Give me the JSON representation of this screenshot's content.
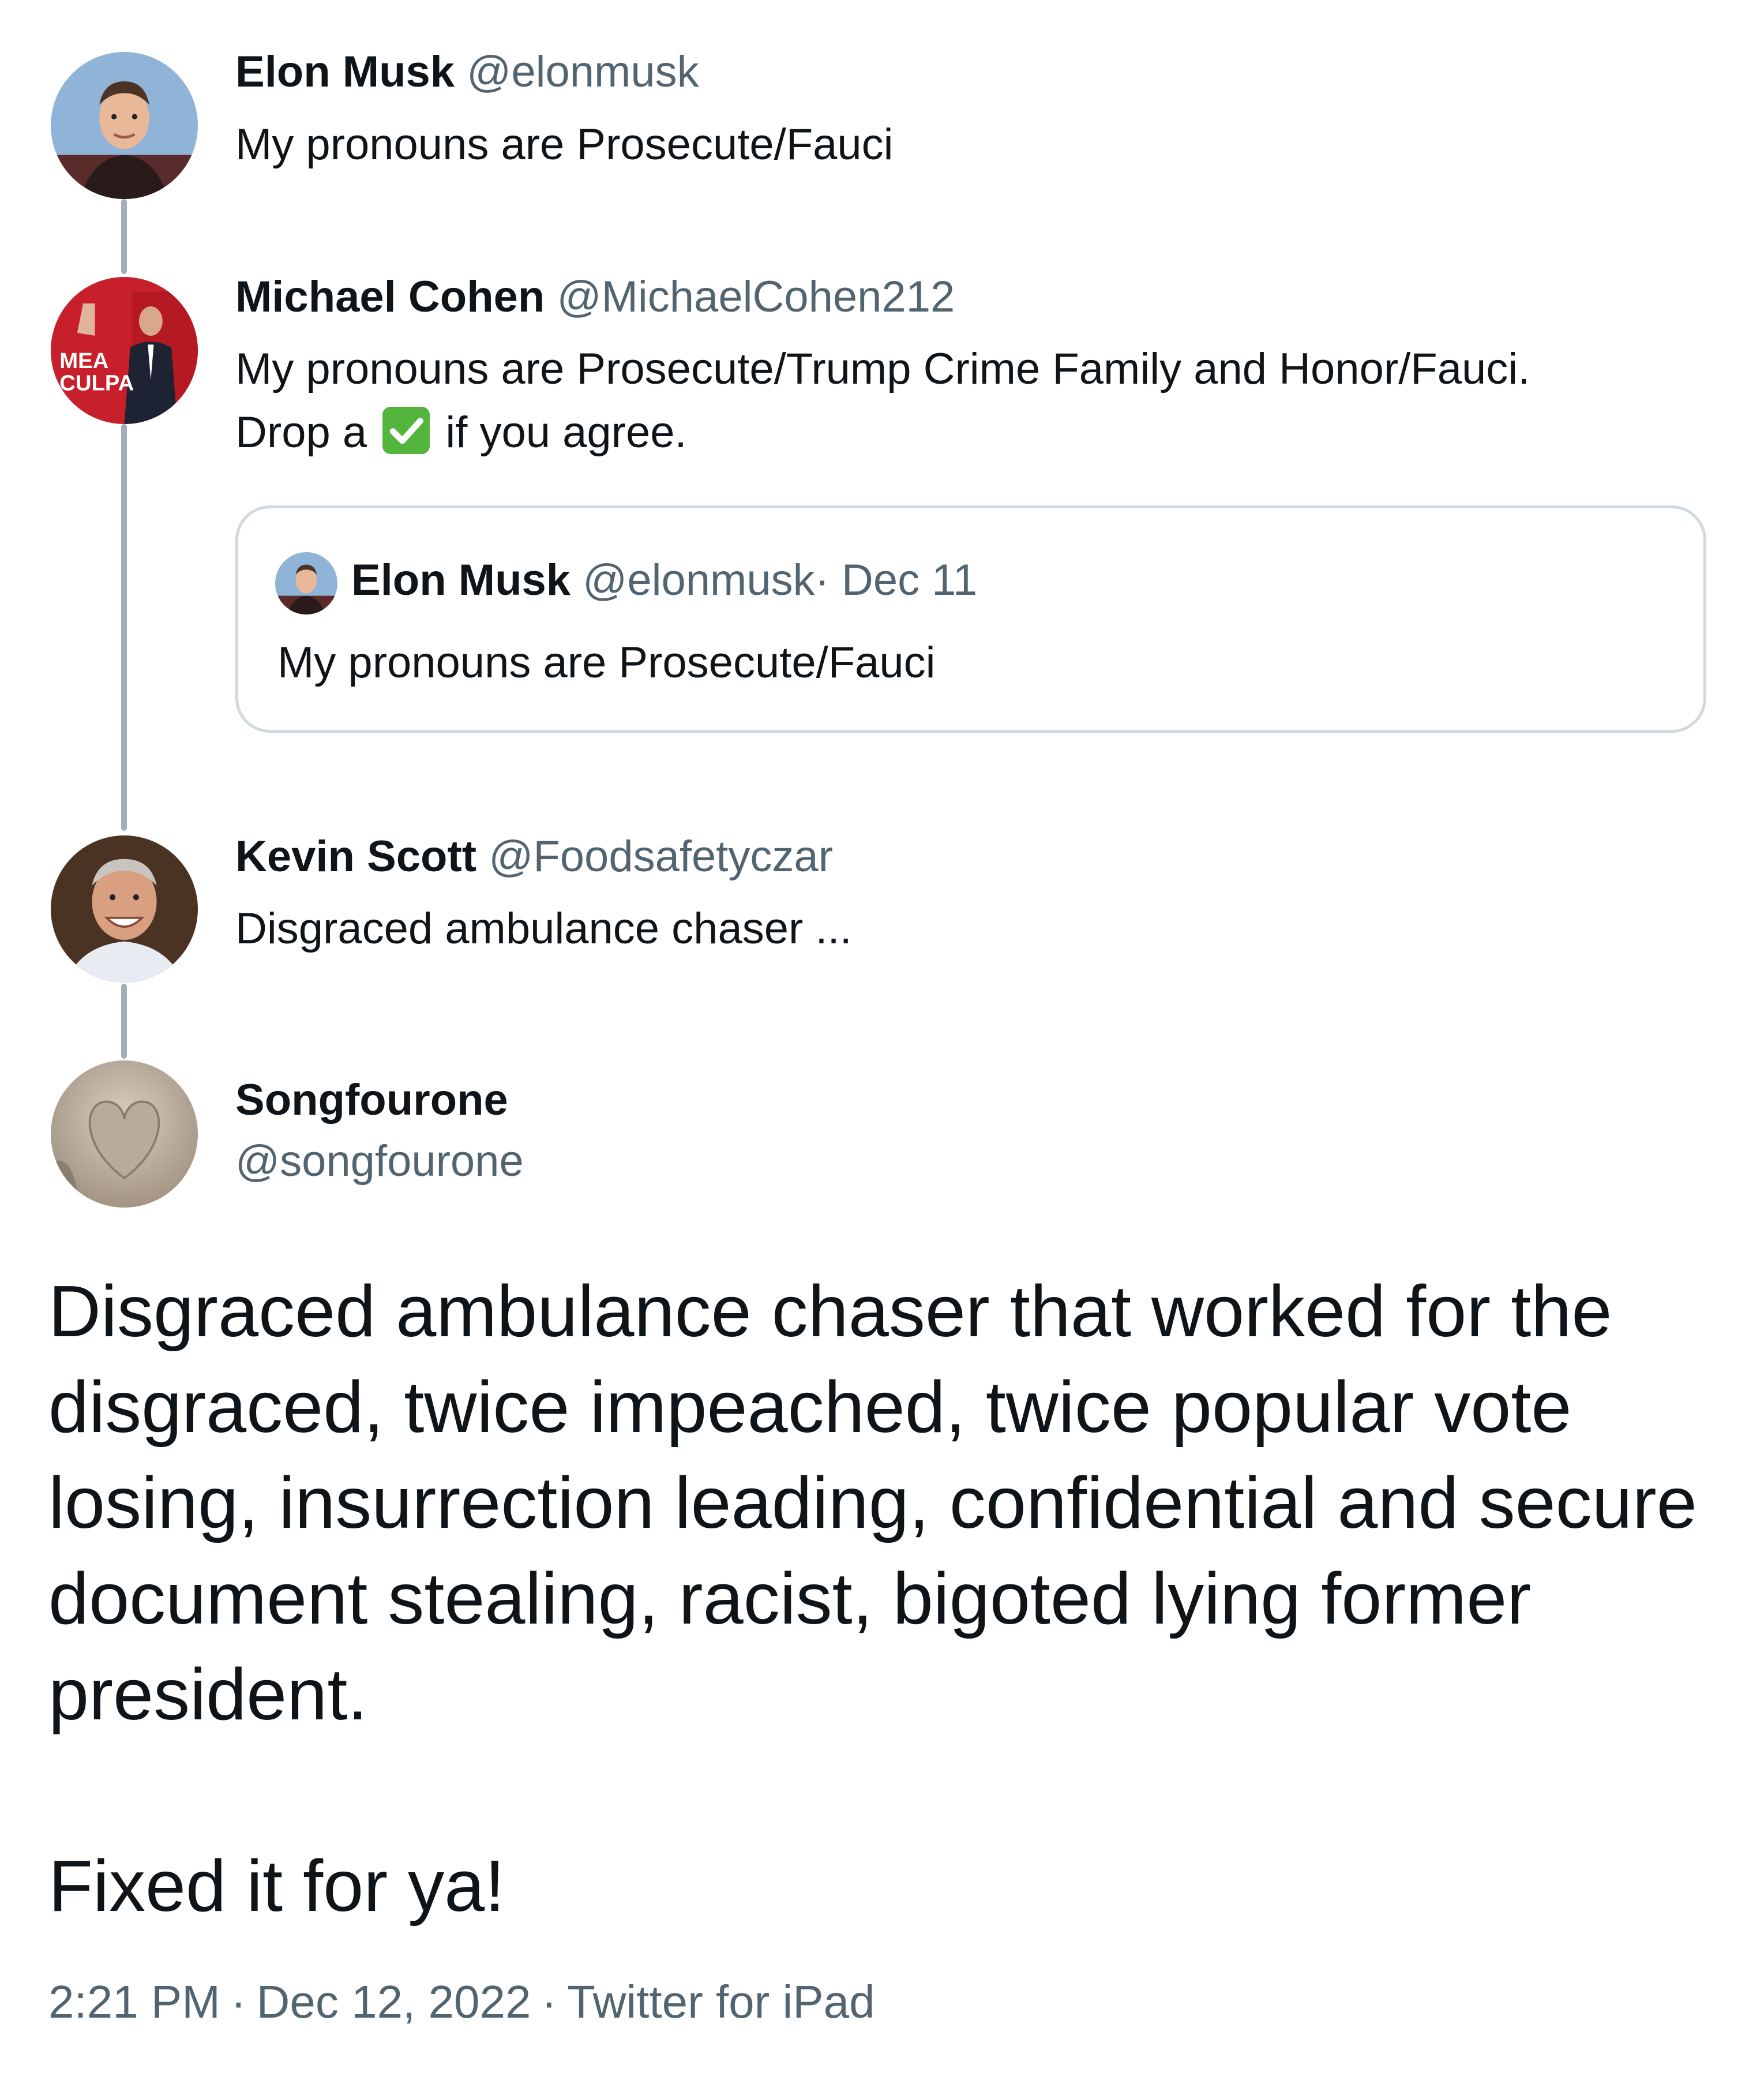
{
  "thread": [
    {
      "name": "Elon Musk",
      "handle": "@elonmusk",
      "text_lines": [
        "My pronouns are Prosecute/Fauci"
      ],
      "avatar_icon": "elon-musk-avatar"
    },
    {
      "name": "Michael Cohen",
      "handle": "@MichaelCohen212",
      "text_lines": [
        "My pronouns are Prosecute/Trump Crime Family and Honor/Fauci."
      ],
      "text_line2_before": "Drop a",
      "text_line2_after": "if you agree.",
      "emoji": "white-heavy-check-mark",
      "avatar_icon": "mea-culpa-avatar",
      "avatar_text": [
        "MEA",
        "CULPA"
      ],
      "quote": {
        "name": "Elon Musk",
        "handle": "@elonmusk",
        "date": "· Dec 11",
        "text": "My pronouns are Prosecute/Fauci"
      }
    },
    {
      "name": "Kevin Scott",
      "handle": "@Foodsafetyczar",
      "text_lines": [
        "Disgraced ambulance chaser ..."
      ],
      "avatar_icon": "kevin-scott-avatar"
    }
  ],
  "main_tweet": {
    "name": "Songfourone",
    "handle": "@songfourone",
    "avatar_icon": "heart-sculpture-avatar",
    "paragraph1": "Disgraced ambulance chaser that worked for the disgraced, twice impeached, twice popular vote losing, insurrection leading, confidential and secure document stealing, racist, bigoted lying former president.",
    "paragraph2": "Fixed it for ya!",
    "time": "2:21 PM",
    "date": "Dec 12, 2022",
    "source": "Twitter for iPad",
    "separator": "·"
  },
  "colors": {
    "text": "#0f1419",
    "secondary": "#536471",
    "thread_line": "#a3aeb9",
    "card_border": "#cfd9de",
    "checkmark_green": "#53b53c"
  }
}
